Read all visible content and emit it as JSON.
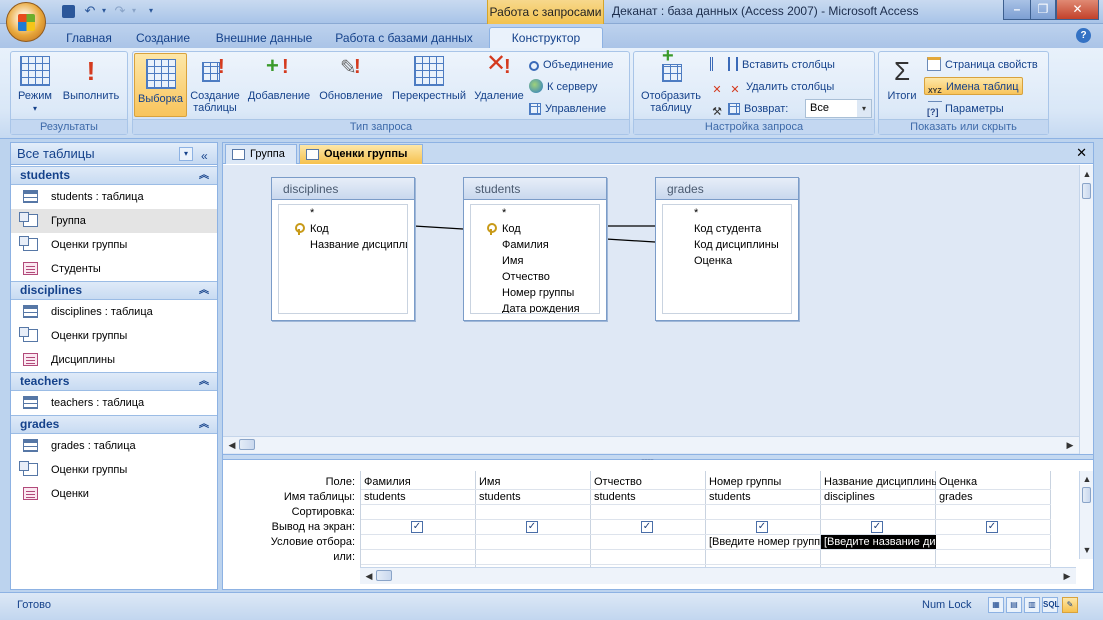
{
  "window": {
    "context_tab": "Работа с запросами",
    "title": "Деканат : база данных (Access 2007) - Microsoft Access"
  },
  "ribbon": {
    "tabs": [
      "Главная",
      "Создание",
      "Внешние данные",
      "Работа с базами данных",
      "Конструктор"
    ],
    "active_tab": "Конструктор",
    "groups": {
      "results": {
        "label": "Результаты",
        "mode": "Режим",
        "run": "Выполнить"
      },
      "query_type": {
        "label": "Тип запроса",
        "select": "Выборка",
        "make_table_1": "Создание",
        "make_table_2": "таблицы",
        "append": "Добавление",
        "update": "Обновление",
        "crosstab": "Перекрестный",
        "delete": "Удаление",
        "union": "Объединение",
        "passthrough": "К серверу",
        "data_definition": "Управление"
      },
      "query_setup": {
        "label": "Настройка запроса",
        "show_table_1": "Отобразить",
        "show_table_2": "таблицу",
        "insert_columns": "Вставить столбцы",
        "delete_columns": "Удалить столбцы",
        "return_label": "Возврат:",
        "return_value": "Все"
      },
      "show_hide": {
        "label": "Показать или скрыть",
        "totals": "Итоги",
        "property_sheet": "Страница свойств",
        "table_names": "Имена таблиц",
        "parameters": "Параметры"
      }
    }
  },
  "nav": {
    "header": "Все таблицы",
    "groups": [
      {
        "name": "students",
        "items": [
          {
            "label": "students : таблица",
            "icon": "table-icon"
          },
          {
            "label": "Группа",
            "icon": "query-icon",
            "selected": true
          },
          {
            "label": "Оценки группы",
            "icon": "query-icon"
          },
          {
            "label": "Студенты",
            "icon": "form-icon"
          }
        ]
      },
      {
        "name": "disciplines",
        "items": [
          {
            "label": "disciplines : таблица",
            "icon": "table-icon"
          },
          {
            "label": "Оценки группы",
            "icon": "query-icon"
          },
          {
            "label": "Дисциплины",
            "icon": "form-icon"
          }
        ]
      },
      {
        "name": "teachers",
        "items": [
          {
            "label": "teachers : таблица",
            "icon": "table-icon"
          }
        ]
      },
      {
        "name": "grades",
        "items": [
          {
            "label": "grades : таблица",
            "icon": "table-icon"
          },
          {
            "label": "Оценки группы",
            "icon": "query-icon"
          },
          {
            "label": "Оценки",
            "icon": "form-icon"
          }
        ]
      }
    ]
  },
  "doc_tabs": [
    {
      "label": "Группа",
      "active": false
    },
    {
      "label": "Оценки группы",
      "active": true
    }
  ],
  "tables": [
    {
      "name": "disciplines",
      "fields": [
        "*",
        "Код",
        "Название дисциплины"
      ],
      "key_index": 1
    },
    {
      "name": "students",
      "fields": [
        "*",
        "Код",
        "Фамилия",
        "Имя",
        "Отчество",
        "Номер группы",
        "Дата рождения"
      ],
      "key_index": 1
    },
    {
      "name": "grades",
      "fields": [
        "*",
        "Код студента",
        "Код дисциплины",
        "Оценка"
      ],
      "key_index": -1
    }
  ],
  "qbe": {
    "row_labels": [
      "Поле:",
      "Имя таблицы:",
      "Сортировка:",
      "Вывод на экран:",
      "Условие отбора:",
      "или:"
    ],
    "columns": [
      {
        "field": "Фамилия",
        "table": "students",
        "show": true,
        "criteria": ""
      },
      {
        "field": "Имя",
        "table": "students",
        "show": true,
        "criteria": ""
      },
      {
        "field": "Отчество",
        "table": "students",
        "show": true,
        "criteria": ""
      },
      {
        "field": "Номер группы",
        "table": "students",
        "show": true,
        "criteria": "[Введите номер группы]"
      },
      {
        "field": "Название дисциплины",
        "table": "disciplines",
        "show": true,
        "criteria": "[Введите название дисциплины]"
      },
      {
        "field": "Оценка",
        "table": "grades",
        "show": true,
        "criteria": ""
      }
    ]
  },
  "status": {
    "text": "Готово",
    "numlock": "Num Lock",
    "sql": "SQL"
  }
}
